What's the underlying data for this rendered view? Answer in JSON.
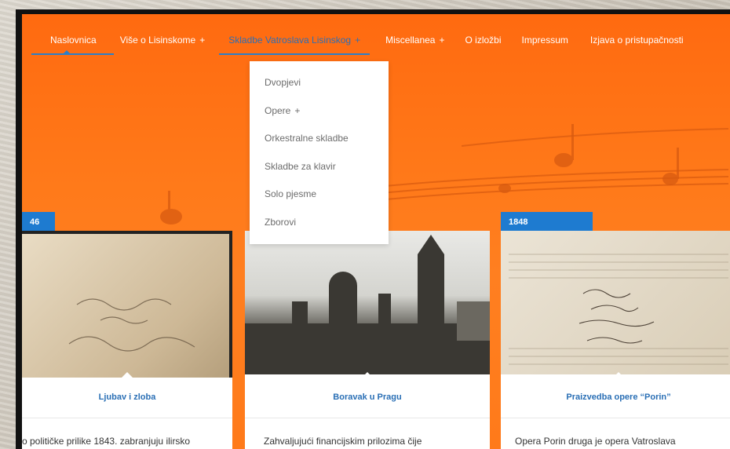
{
  "nav": {
    "items": [
      {
        "label": "Naslovnica",
        "plus": ""
      },
      {
        "label": "Više o Lisinskome",
        "plus": "+"
      },
      {
        "label": "Skladbe Vatroslava Lisinskog",
        "plus": "+"
      },
      {
        "label": "Miscellanea",
        "plus": "+"
      },
      {
        "label": "O izložbi",
        "plus": ""
      },
      {
        "label": "Impressum",
        "plus": ""
      },
      {
        "label": "Izjava o pristupačnosti",
        "plus": ""
      }
    ]
  },
  "dropdown": {
    "items": [
      {
        "label": "Dvopjevi",
        "plus": ""
      },
      {
        "label": "Opere",
        "plus": "+"
      },
      {
        "label": "Orkestralne skladbe",
        "plus": ""
      },
      {
        "label": "Skladbe za klavir",
        "plus": ""
      },
      {
        "label": "Solo pjesme",
        "plus": ""
      },
      {
        "label": "Zborovi",
        "plus": ""
      }
    ]
  },
  "cards": [
    {
      "year": "46",
      "title": "Ljubav i zloba",
      "text": "o političke prilike 1843. zabranjuju ilirsko"
    },
    {
      "year": "",
      "title": "Boravak u Pragu",
      "text": "Zahvaljujući financijskim prilozima čije"
    },
    {
      "year": "1848",
      "title": "Praizvedba opere “Porin”",
      "text": "Opera Porin druga je opera Vatroslava"
    }
  ],
  "colors": {
    "accent": "#1e7bd0",
    "hero": "#ff7a1a",
    "link": "#2a6fb5"
  }
}
